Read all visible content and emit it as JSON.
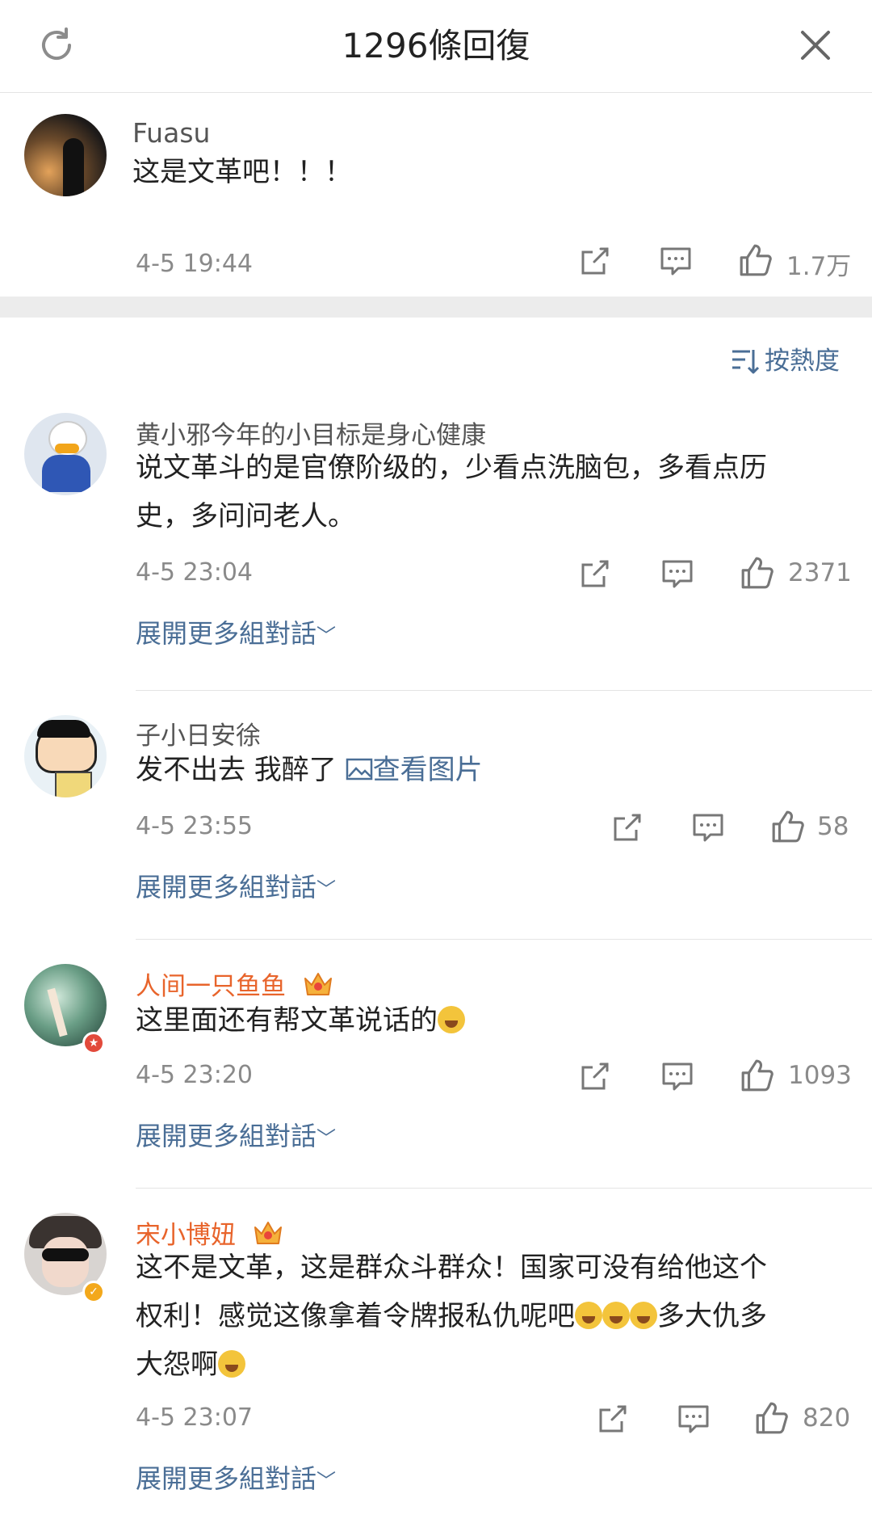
{
  "header": {
    "title": "1296條回復"
  },
  "main_post": {
    "username": "Fuasu",
    "text": "这是文革吧！！！",
    "time": "4-5 19:44",
    "likes": "1.7万"
  },
  "sort": {
    "label": "按熱度"
  },
  "comments": [
    {
      "username": "黄小邪今年的小目标是身心健康",
      "text_line1": "说文革斗的是官僚阶级的，少看点洗脑包，多看点历",
      "text_line2": "史，多问问老人。",
      "time": "4-5 23:04",
      "likes": "2371",
      "expand": "展開更多組對話"
    },
    {
      "username": "子小日安徐",
      "text": "发不出去 我醉了",
      "link": "查看图片",
      "time": "4-5 23:55",
      "likes": "58",
      "expand": "展開更多組對話"
    },
    {
      "username": "人间一只鱼鱼",
      "text": "这里面还有帮文革说话的",
      "time": "4-5 23:20",
      "likes": "1093",
      "expand": "展開更多組對話"
    },
    {
      "username": "宋小博妞",
      "text_line1": "这不是文革，这是群众斗群众！国家可没有给他这个",
      "text_line2a": "权利！感觉这像拿着令牌报私仇呢吧",
      "text_line2b": "多大仇多",
      "text_line3": "大怨啊",
      "time": "4-5 23:07",
      "likes": "820",
      "expand": "展開更多組對話"
    }
  ],
  "colors": {
    "link": "#4a6e96",
    "vip_name": "#e8642b",
    "meta": "#8a8a8a"
  },
  "icons": [
    "refresh-icon",
    "close-icon",
    "share-icon",
    "comment-icon",
    "like-icon",
    "sort-icon",
    "image-icon",
    "crown-icon",
    "laugh-cry-emoji",
    "surprised-emoji"
  ]
}
